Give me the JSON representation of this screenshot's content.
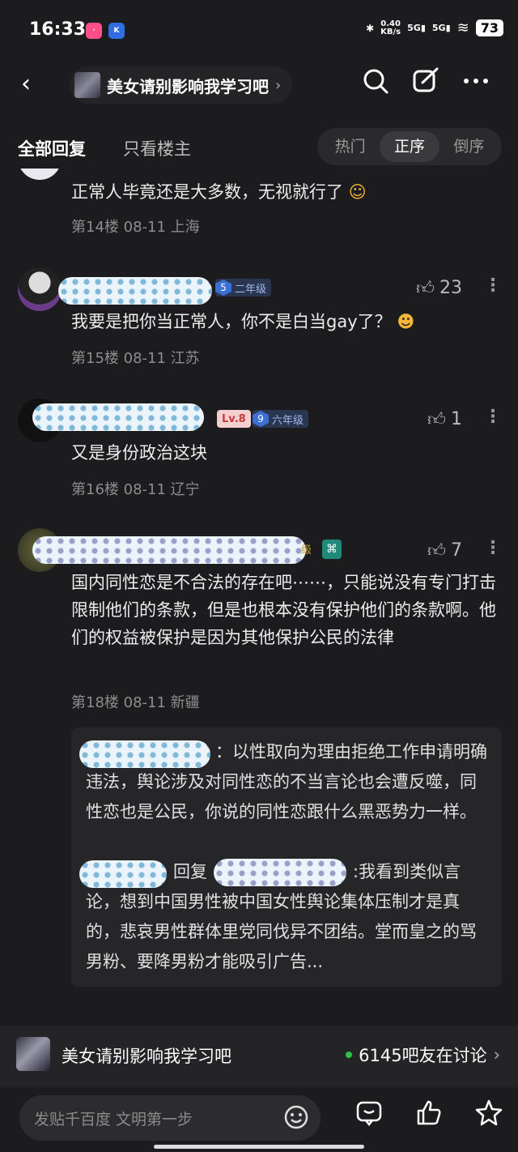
{
  "status_bar": {
    "time": "16:33",
    "net_speed_value": "0.40",
    "net_speed_unit": "KB/s",
    "sig1": "5G",
    "sig2": "5G",
    "battery": "73"
  },
  "header": {
    "forum_name": "美女请别影响我学习吧",
    "chevron": "›"
  },
  "tabs": {
    "all": "全部回复",
    "owner_only": "只看楼主"
  },
  "sort": {
    "options": [
      "热门",
      "正序",
      "倒序"
    ],
    "active": "正序"
  },
  "posts": [
    {
      "text": "正常人毕竟还是大多数，无视就行了",
      "meta": "第14楼 08-11 上海"
    },
    {
      "level": "5",
      "grade": "二年级",
      "likes": "23",
      "text": "我要是把你当正常人，你不是白当gay了？",
      "meta": "第15楼 08-11 江苏"
    },
    {
      "lv": "Lv.8",
      "level": "9",
      "grade": "六年级",
      "likes": "1",
      "text": "又是身份政治这块",
      "meta": "第16楼 08-11 辽宁"
    },
    {
      "grade_tail": "级",
      "likes": "7",
      "text": "国内同性恋是不合法的存在吧⋯⋯，只能说没有专门打击限制他们的条款，但是也根本没有保护他们的条款啊。他们的权益被保护是因为其他保护公民的法律",
      "meta": "第18楼 08-11 新疆"
    }
  ],
  "sub_replies": {
    "reply1": "：以性取向为理由拒绝工作申请明确违法，舆论涉及对同性恋的不当言论也会遭反噬，同性恋也是公民，你说的同性恋跟什么黑恶势力一样。",
    "reply_word": "回复",
    "reply2": ":我看到类似言论，想到中国男性被中国女性舆论集体压制才是真的，悲哀男性群体里党同伐异不团结。堂而皇之的骂男粉、要降男粉才能吸引广告..."
  },
  "forum_bar": {
    "name": "美女请别影响我学习吧",
    "count": "6145吧友在讨论"
  },
  "input": {
    "placeholder": "发贴千百度 文明第一步"
  }
}
